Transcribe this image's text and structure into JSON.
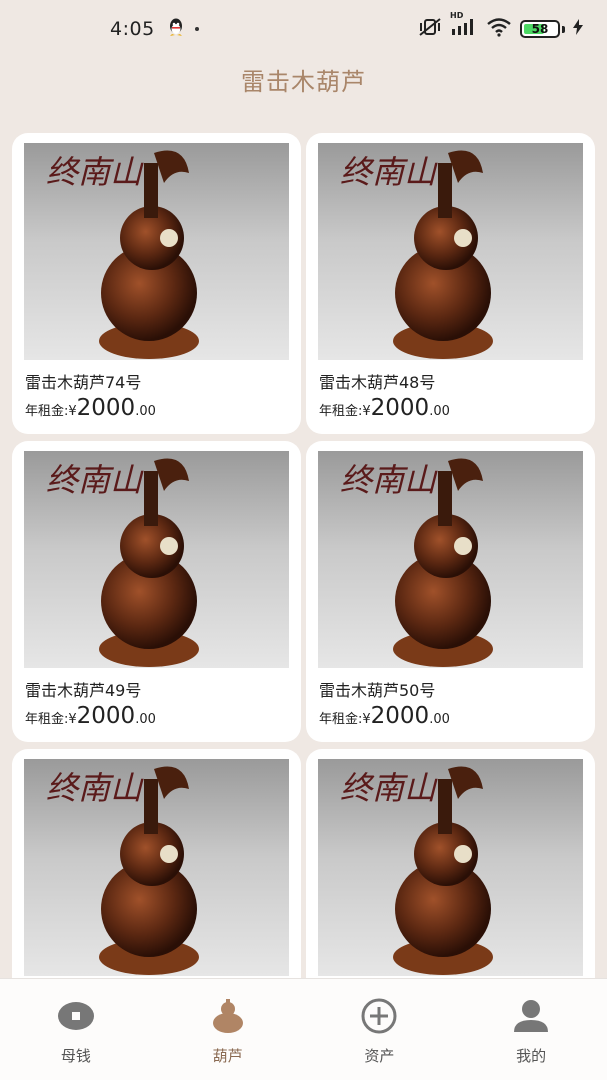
{
  "status_bar": {
    "time": "4:05",
    "battery": "58",
    "network": "HD"
  },
  "header": {
    "title": "雷击木葫芦"
  },
  "products": [
    {
      "name": "雷击木葫芦74号",
      "price_label": "年租金:¥",
      "price_int": "2000",
      "price_dec": ".00",
      "brand": "终南山"
    },
    {
      "name": "雷击木葫芦48号",
      "price_label": "年租金:¥",
      "price_int": "2000",
      "price_dec": ".00",
      "brand": "终南山"
    },
    {
      "name": "雷击木葫芦49号",
      "price_label": "年租金:¥",
      "price_int": "2000",
      "price_dec": ".00",
      "brand": "终南山"
    },
    {
      "name": "雷击木葫芦50号",
      "price_label": "年租金:¥",
      "price_int": "2000",
      "price_dec": ".00",
      "brand": "终南山"
    },
    {
      "name": "",
      "price_label": "",
      "price_int": "",
      "price_dec": "",
      "brand": "终南山"
    },
    {
      "name": "",
      "price_label": "",
      "price_int": "",
      "price_dec": "",
      "brand": "终南山"
    }
  ],
  "tab_bar": {
    "items": [
      {
        "label": "母钱",
        "icon": "coin-icon",
        "active": false
      },
      {
        "label": "葫芦",
        "icon": "gourd-icon",
        "active": true
      },
      {
        "label": "资产",
        "icon": "plus-circle-icon",
        "active": false
      },
      {
        "label": "我的",
        "icon": "user-icon",
        "active": false
      }
    ]
  },
  "colors": {
    "background": "#efe8e3",
    "accent": "#a9866a",
    "active_tab_icon": "#b08565",
    "inactive_tab_icon": "#777777"
  }
}
